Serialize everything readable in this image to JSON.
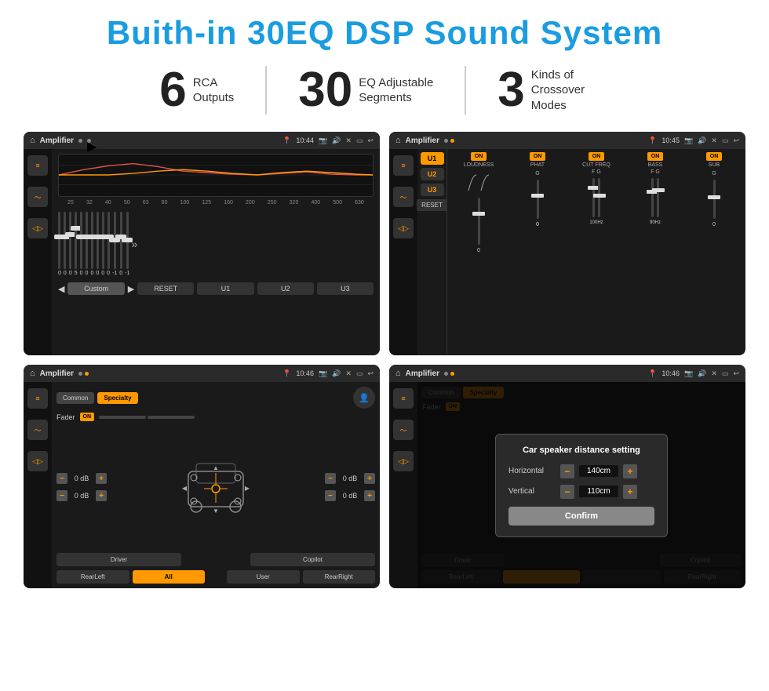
{
  "title": "Buith-in 30EQ DSP Sound System",
  "stats": [
    {
      "number": "6",
      "text": "RCA\nOutputs"
    },
    {
      "number": "30",
      "text": "EQ Adjustable\nSegments"
    },
    {
      "number": "3",
      "text": "Kinds of\nCrossover Modes"
    }
  ],
  "screens": [
    {
      "id": "screen1",
      "topbar": {
        "title": "Amplifier",
        "time": "10:44"
      },
      "eq_labels": [
        "25",
        "32",
        "40",
        "50",
        "63",
        "80",
        "100",
        "125",
        "160",
        "200",
        "250",
        "320",
        "400",
        "500",
        "630"
      ],
      "eq_values": [
        "0",
        "0",
        "0",
        "5",
        "0",
        "0",
        "0",
        "0",
        "0",
        "0",
        "-1",
        "0",
        "-1"
      ],
      "bottom_buttons": [
        "Custom",
        "RESET",
        "U1",
        "U2",
        "U3"
      ]
    },
    {
      "id": "screen2",
      "topbar": {
        "title": "Amplifier",
        "time": "10:45"
      },
      "presets": [
        "U1",
        "U2",
        "U3"
      ],
      "toggles": [
        "ON",
        "ON",
        "ON",
        "ON",
        "ON"
      ],
      "labels": [
        "LOUDNESS",
        "PHAT",
        "CUT FREQ",
        "BASS",
        "SUB"
      ],
      "reset_label": "RESET"
    },
    {
      "id": "screen3",
      "topbar": {
        "title": "Amplifier",
        "time": "10:46"
      },
      "tabs": [
        "Common",
        "Specialty"
      ],
      "fader_label": "Fader",
      "fader_on": "ON",
      "volumes": [
        "0 dB",
        "0 dB",
        "0 dB",
        "0 dB"
      ],
      "bottom_buttons": [
        "Driver",
        "All",
        "Copilot",
        "RearLeft",
        "User",
        "RearRight"
      ]
    },
    {
      "id": "screen4",
      "topbar": {
        "title": "Amplifier",
        "time": "10:46"
      },
      "tabs": [
        "Common",
        "Specialty"
      ],
      "dialog": {
        "title": "Car speaker distance setting",
        "horizontal_label": "Horizontal",
        "horizontal_value": "140cm",
        "vertical_label": "Vertical",
        "vertical_value": "110cm",
        "confirm_label": "Confirm"
      },
      "bottom_buttons": [
        "Driver",
        "RearLeft",
        "Copilot",
        "RearRight"
      ]
    }
  ],
  "colors": {
    "blue": "#1a9de0",
    "orange": "#f90",
    "dark_bg": "#1a1a1a"
  }
}
